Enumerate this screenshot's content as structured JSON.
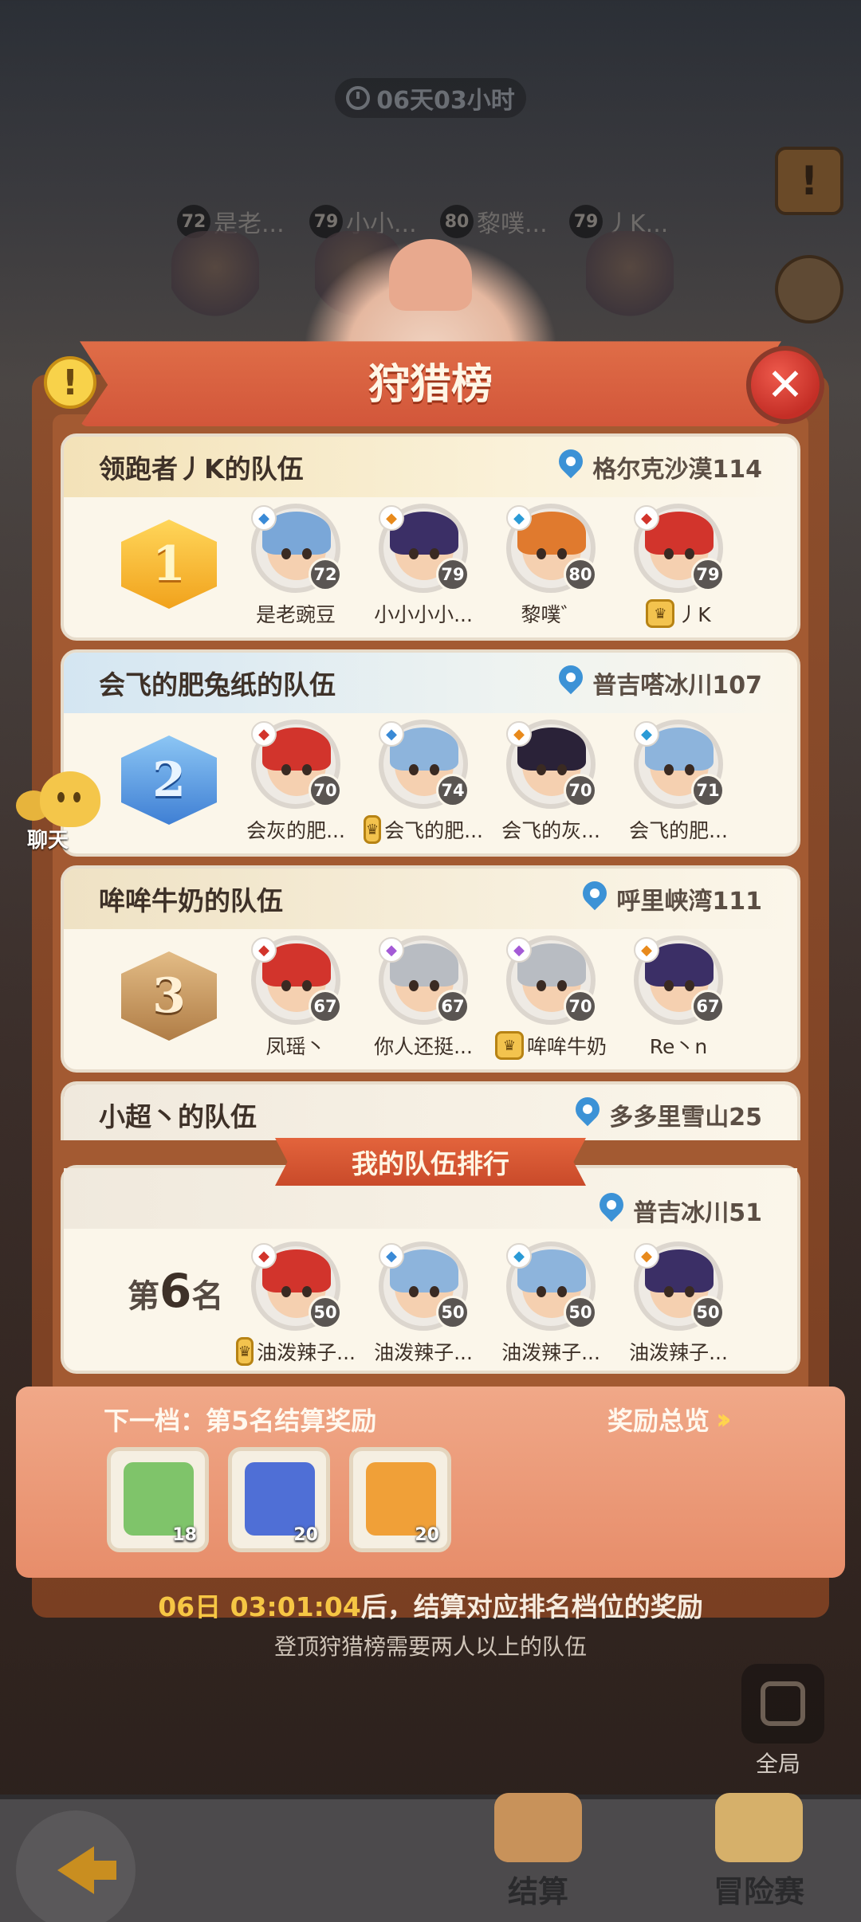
{
  "timer": "06天03小时",
  "bg_players": [
    {
      "level": "72",
      "name": "是老..."
    },
    {
      "level": "79",
      "name": "小小..."
    },
    {
      "level": "80",
      "name": "黎噗..."
    },
    {
      "level": "79",
      "name": "丿K..."
    }
  ],
  "title": "狩猎榜",
  "teams": [
    {
      "rank": "1",
      "name": "领跑者丿K的队伍",
      "location": "格尔克沙漠114",
      "members": [
        {
          "name": "是老豌豆",
          "level": "72",
          "element": "ice",
          "hair": "#7aa7d8",
          "captain": false
        },
        {
          "name": "小小小小...",
          "level": "79",
          "element": "fire",
          "hair": "#3b2f66",
          "captain": false
        },
        {
          "name": "黎噗゛",
          "level": "80",
          "element": "wind",
          "hair": "#e07a2e",
          "captain": false
        },
        {
          "name": "丿K",
          "level": "79",
          "element": "dark",
          "hair": "#d2342c",
          "captain": true
        }
      ]
    },
    {
      "rank": "2",
      "name": "会飞的肥兔纸的队伍",
      "location": "普吉嗒冰川107",
      "members": [
        {
          "name": "会灰的肥...",
          "level": "70",
          "element": "dark",
          "hair": "#d2342c",
          "captain": false
        },
        {
          "name": "会飞的肥...",
          "level": "74",
          "element": "ice",
          "hair": "#8db4dc",
          "captain": true
        },
        {
          "name": "会飞的灰...",
          "level": "70",
          "element": "fire",
          "hair": "#2a2238",
          "captain": false
        },
        {
          "name": "会飞的肥...",
          "level": "71",
          "element": "wind",
          "hair": "#8db4dc",
          "captain": false
        }
      ]
    },
    {
      "rank": "3",
      "name": "哞哞牛奶的队伍",
      "location": "呼里峡湾111",
      "members": [
        {
          "name": "凤瑶丶",
          "level": "67",
          "element": "dark",
          "hair": "#d2342c",
          "captain": false
        },
        {
          "name": "你人还挺...",
          "level": "67",
          "element": "psy",
          "hair": "#b8bcc2",
          "captain": false
        },
        {
          "name": "哞哞牛奶",
          "level": "70",
          "element": "psy",
          "hair": "#b8bcc2",
          "captain": true
        },
        {
          "name": "Re丶n",
          "level": "67",
          "element": "fire",
          "hair": "#3b2f66",
          "captain": false
        }
      ]
    },
    {
      "name": "小超丶的队伍",
      "location": "多多里雪山25"
    }
  ],
  "my_team": {
    "ribbon": "我的队伍排行",
    "location": "普吉冰川51",
    "rank_prefix": "第",
    "rank_value": "6",
    "rank_suffix": "名",
    "members": [
      {
        "name": "油泼辣子...",
        "level": "50",
        "element": "dark",
        "hair": "#d2342c",
        "captain": true
      },
      {
        "name": "油泼辣子...",
        "level": "50",
        "element": "ice",
        "hair": "#8db4dc",
        "captain": false
      },
      {
        "name": "油泼辣子...",
        "level": "50",
        "element": "wind",
        "hair": "#8db4dc",
        "captain": false
      },
      {
        "name": "油泼辣子...",
        "level": "50",
        "element": "fire",
        "hair": "#3b2f66",
        "captain": false
      }
    ]
  },
  "rewards": {
    "next_tier": "下一档：第5名结算奖励",
    "overview": "奖励总览",
    "items": [
      {
        "icon": "green-ticket-icon",
        "count": "18",
        "color": "#7fc46a"
      },
      {
        "icon": "blue-crystal-icon",
        "count": "20",
        "color": "#4f6fd6"
      },
      {
        "icon": "orange-scroll-icon",
        "count": "20",
        "color": "#f0a038"
      }
    ]
  },
  "countdown_time": "06日 03:01:04",
  "countdown_text": "后，结算对应排名档位的奖励",
  "hint": "登顶狩猎榜需要两人以上的队伍",
  "chat_label": "聊天",
  "global_label": "全局",
  "nav": {
    "settle": "结算",
    "adventure": "冒险赛"
  },
  "element_colors": {
    "ice": "#3a8ad6",
    "fire": "#e88a1c",
    "wind": "#2a9ad6",
    "dark": "#d2342c",
    "psy": "#a35ad6"
  }
}
